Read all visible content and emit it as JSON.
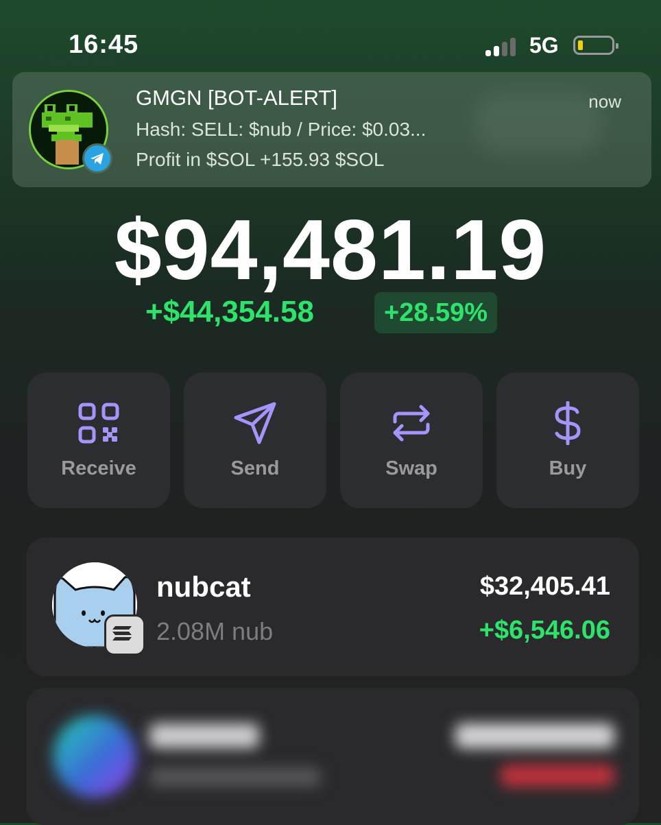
{
  "status_bar": {
    "time": "16:45",
    "network": "5G",
    "battery_level": 0.1
  },
  "notification": {
    "title": "GMGN [BOT-ALERT]",
    "line1": "Hash: SELL: $nub / Price: $0.03...",
    "line2": "Profit in $SOL +155.93 $SOL",
    "time": "now",
    "avatar_icon": "pixel-frog-avatar",
    "badge_icon": "telegram-icon"
  },
  "portfolio": {
    "balance": "$94,481.19",
    "change_amount": "+$44,354.58",
    "change_percent": "+28.59%"
  },
  "actions": [
    {
      "label": "Receive",
      "icon": "qr-code-icon"
    },
    {
      "label": "Send",
      "icon": "send-icon"
    },
    {
      "label": "Swap",
      "icon": "swap-icon"
    },
    {
      "label": "Buy",
      "icon": "dollar-icon"
    }
  ],
  "tokens": [
    {
      "name": "nubcat",
      "amount": "2.08M nub",
      "value": "$32,405.41",
      "pnl": "+$6,546.06",
      "icon": "nubcat-avatar",
      "chain_icon": "solana-icon"
    }
  ],
  "colors": {
    "accent_purple": "#a594f9",
    "profit_green": "#2ee36b",
    "card_bg": "#2c2d30"
  }
}
